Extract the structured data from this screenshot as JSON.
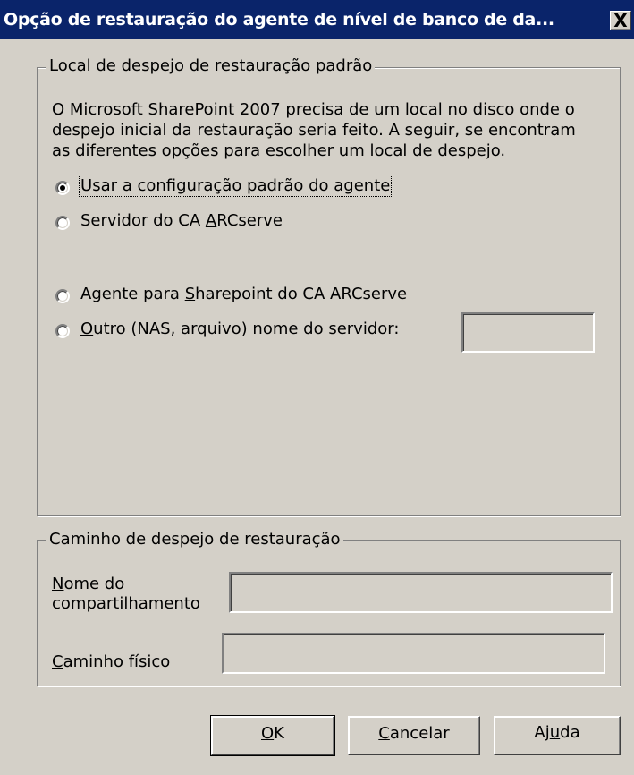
{
  "window": {
    "title": "Opção de restauração do agente de nível de banco de da...",
    "close_glyph": "X"
  },
  "group_local": {
    "legend": "Local de despejo de restauração padrão",
    "description_lines": [
      "O Microsoft SharePoint 2007 precisa de um local no disco onde o",
      "despejo inicial da restauração seria feito. A seguir, se encontram",
      "as diferentes opções para escolher um local de despejo."
    ],
    "options": [
      {
        "pre": "",
        "key": "U",
        "post": "sar a configuração padrão do agente",
        "selected": true
      },
      {
        "pre": "Servidor do CA ",
        "key": "A",
        "post": "RCserve",
        "selected": false
      },
      {
        "pre": "Agente para ",
        "key": "S",
        "post": "harepoint do CA ARCserve",
        "selected": false
      },
      {
        "pre": "",
        "key": "O",
        "post": "utro (NAS, arquivo)  nome do servidor:",
        "selected": false
      }
    ],
    "server_name_value": ""
  },
  "group_path": {
    "legend": "Caminho de despejo de restauração",
    "share_label": {
      "key": "N",
      "line1_rest": "ome do",
      "line2": "compartilhamento"
    },
    "share_value": "",
    "physical_label": {
      "key": "C",
      "rest": "aminho físico"
    },
    "physical_value": ""
  },
  "buttons": {
    "ok": {
      "key": "O",
      "rest": "K"
    },
    "cancel": {
      "key": "C",
      "rest": "ancelar"
    },
    "help": {
      "pre": "Aj",
      "key": "u",
      "rest": "da"
    }
  }
}
